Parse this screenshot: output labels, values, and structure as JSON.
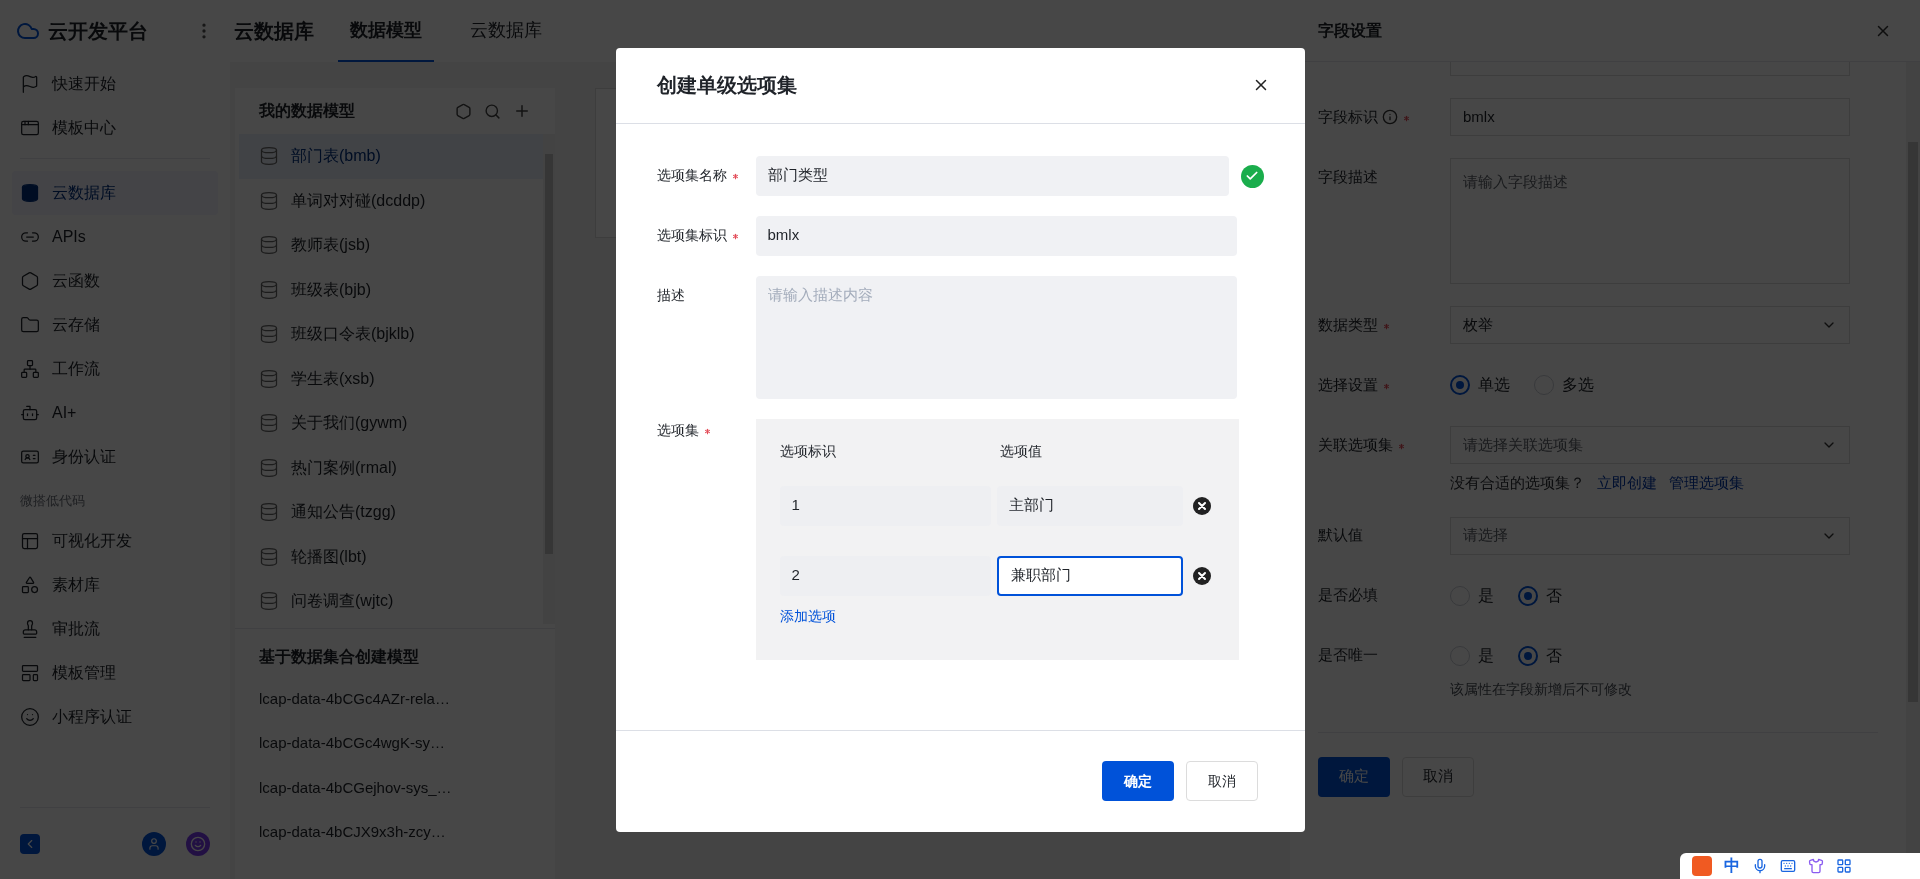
{
  "sidebar": {
    "brand": "云开发平台",
    "groups": [
      {
        "items": [
          {
            "label": "快速开始",
            "selected": false
          },
          {
            "label": "模板中心",
            "selected": false
          }
        ]
      },
      {
        "items": [
          {
            "label": "云数据库",
            "selected": true
          },
          {
            "label": "APIs",
            "selected": false
          },
          {
            "label": "云函数",
            "selected": false
          },
          {
            "label": "云存储",
            "selected": false
          },
          {
            "label": "工作流",
            "selected": false
          },
          {
            "label": "AI+",
            "selected": false
          },
          {
            "label": "身份认证",
            "selected": false
          }
        ]
      },
      {
        "heading": "微搭低代码",
        "items": [
          {
            "label": "可视化开发",
            "selected": false
          },
          {
            "label": "素材库",
            "selected": false
          },
          {
            "label": "审批流",
            "selected": false
          },
          {
            "label": "模板管理",
            "selected": false
          },
          {
            "label": "小程序认证",
            "selected": false
          }
        ]
      }
    ]
  },
  "topbar": {
    "title": "云数据库",
    "tabs": [
      {
        "label": "数据模型",
        "selected": true
      },
      {
        "label": "云数据库",
        "selected": false
      }
    ]
  },
  "models": {
    "title": "我的数据模型",
    "items": [
      {
        "label": "部门表(bmb)",
        "selected": true
      },
      {
        "label": "单词对对碰(dcddp)",
        "selected": false
      },
      {
        "label": "教师表(jsb)",
        "selected": false
      },
      {
        "label": "班级表(bjb)",
        "selected": false
      },
      {
        "label": "班级口令表(bjklb)",
        "selected": false
      },
      {
        "label": "学生表(xsb)",
        "selected": false
      },
      {
        "label": "关于我们(gywm)",
        "selected": false
      },
      {
        "label": "热门案例(rmal)",
        "selected": false
      },
      {
        "label": "通知公告(tzgg)",
        "selected": false
      },
      {
        "label": "轮播图(lbt)",
        "selected": false
      },
      {
        "label": "问卷调查(wjtc)",
        "selected": false
      }
    ],
    "dataset_title": "基于数据集合创建模型",
    "dataset_items": [
      "lcap-data-4bCGc4AZr-rela…",
      "lcap-data-4bCGc4wgK-sy…",
      "lcap-data-4bCGejhov-sys_…",
      "lcap-data-4bCJX9x3h-zcy…"
    ]
  },
  "drawer": {
    "title": "字段设置",
    "fields": [
      {
        "kind": "input",
        "label": "字段标识",
        "required": true,
        "info": true,
        "value": "bmlx"
      },
      {
        "kind": "textarea",
        "label": "字段描述",
        "required": false,
        "placeholder": "请输入字段描述"
      },
      {
        "kind": "select",
        "label": "数据类型",
        "required": true,
        "value": "枚举"
      },
      {
        "kind": "radio",
        "label": "选择设置",
        "required": true,
        "options": [
          {
            "label": "单选",
            "selected": true
          },
          {
            "label": "多选",
            "selected": false
          }
        ]
      },
      {
        "kind": "select",
        "label": "关联选项集",
        "required": true,
        "placeholder": "请选择关联选项集",
        "hint": "没有合适的选项集？",
        "links": [
          "立即创建",
          "管理选项集"
        ]
      },
      {
        "kind": "select",
        "label": "默认值",
        "required": false,
        "placeholder": "请选择"
      },
      {
        "kind": "radio",
        "label": "是否必填",
        "required": false,
        "options": [
          {
            "label": "是",
            "selected": false
          },
          {
            "label": "否",
            "selected": true
          }
        ]
      },
      {
        "kind": "radio",
        "label": "是否唯一",
        "required": false,
        "options": [
          {
            "label": "是",
            "selected": false
          },
          {
            "label": "否",
            "selected": true
          }
        ],
        "note": "该属性在字段新增后不可修改"
      }
    ],
    "buttons": [
      {
        "label": "确定",
        "kind": "primary"
      },
      {
        "label": "取消",
        "kind": "secondary"
      }
    ]
  },
  "modal": {
    "title": "创建单级选项集",
    "fields": [
      {
        "kind": "input",
        "label": "选项集名称",
        "required": true,
        "value": "部门类型",
        "valid": true
      },
      {
        "kind": "input",
        "label": "选项集标识",
        "required": true,
        "value": "bmlx",
        "valid": false
      },
      {
        "kind": "textarea",
        "label": "描述",
        "required": false,
        "placeholder": "请输入描述内容"
      }
    ],
    "options": {
      "label": "选项集",
      "required": true,
      "columns": [
        "选项标识",
        "选项值"
      ],
      "rows": [
        {
          "key": "1",
          "value": "主部门",
          "focused": false
        },
        {
          "key": "2",
          "value": "兼职部门",
          "focused": true
        }
      ],
      "add_link": "添加选项"
    },
    "buttons": [
      {
        "label": "确定",
        "kind": "primary"
      },
      {
        "label": "取消",
        "kind": "secondary"
      }
    ]
  },
  "ime": {
    "mode": "中"
  }
}
